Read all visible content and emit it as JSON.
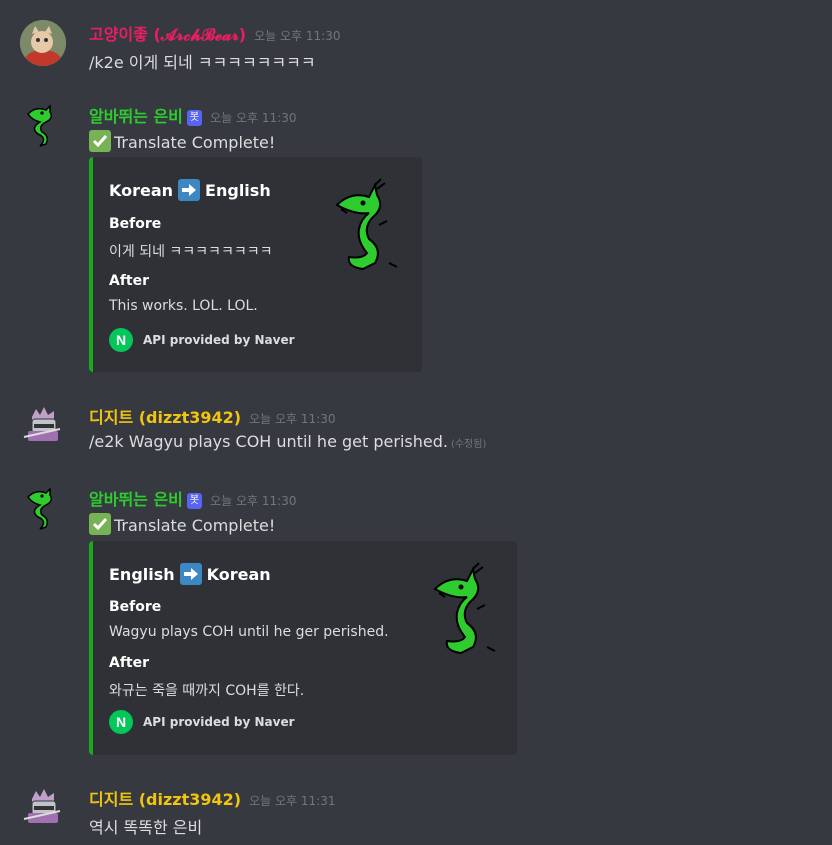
{
  "colors": {
    "background": "#36393f",
    "embed_background": "#2f3136",
    "embed_accent": "#1aaa1a",
    "user1_color": "#e91e63",
    "bot_color": "#2ecc2e",
    "user2_color": "#f1c40f",
    "bot_tag": "#5865f2",
    "naver_green": "#03c75a"
  },
  "messages": [
    {
      "username": "고양이좋 (𝓐𝓻𝓬𝓱𝓑𝓮𝓪𝓻)",
      "timestamp": "오늘 오후 11:30",
      "text": "/k2e 이게 되네 ㅋㅋㅋㅋㅋㅋㅋㅋ",
      "avatar": "cat-avatar"
    },
    {
      "username": "알바뛰는 은비",
      "bot_tag": "봇",
      "timestamp": "오늘 오후 11:30",
      "text": "Translate Complete!",
      "avatar": "green-dragon-avatar",
      "embed": {
        "from_lang": "Korean",
        "to_lang": "English",
        "before_label": "Before",
        "before_text": "이게 되네 ㅋㅋㅋㅋㅋㅋㅋㅋ",
        "after_label": "After",
        "after_text": "This works. LOL. LOL.",
        "footer_icon": "N",
        "footer_text": "API provided by Naver"
      }
    },
    {
      "username": "디지트 (dizzt3942)",
      "timestamp": "오늘 오후 11:30",
      "text": "/e2k Wagyu plays COH until he get perished.",
      "edited": "(수정됨)",
      "avatar": "knight-avatar"
    },
    {
      "username": "알바뛰는 은비",
      "bot_tag": "봇",
      "timestamp": "오늘 오후 11:30",
      "text": "Translate Complete!",
      "avatar": "green-dragon-avatar",
      "embed": {
        "from_lang": "English",
        "to_lang": "Korean",
        "before_label": "Before",
        "before_text": "Wagyu plays COH until he ger perished.",
        "after_label": "After",
        "after_text": "와규는 죽을 때까지 COH를 한다.",
        "footer_icon": "N",
        "footer_text": "API provided by Naver"
      }
    },
    {
      "username": "디지트 (dizzt3942)",
      "timestamp": "오늘 오후 11:31",
      "text": "역시 똑똑한 은비",
      "avatar": "knight-avatar"
    }
  ]
}
